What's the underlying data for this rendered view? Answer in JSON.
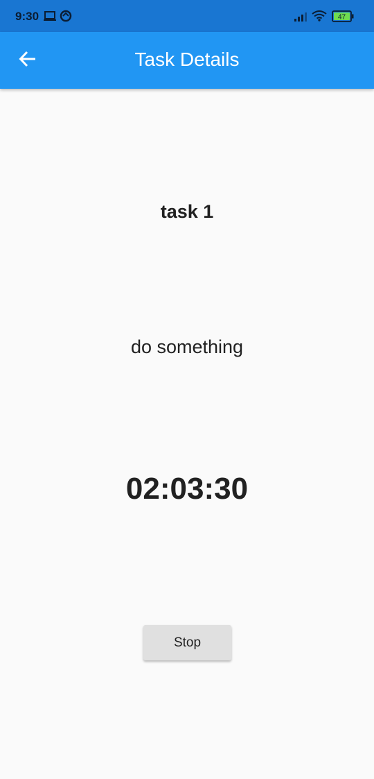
{
  "status_bar": {
    "time": "9:30",
    "battery": "47",
    "icons": [
      "laptop-icon",
      "sync-icon",
      "signal-icon",
      "wifi-icon",
      "battery-icon"
    ]
  },
  "app_bar": {
    "title": "Task Details",
    "back_icon": "arrow-back-icon"
  },
  "task": {
    "title": "task 1",
    "description": "do something",
    "timer": "02:03:30"
  },
  "actions": {
    "stop_label": "Stop"
  },
  "colors": {
    "status_bar": "#1976d2",
    "app_bar": "#2196f3",
    "background": "#fafafa",
    "button": "#e0e0e0",
    "text": "#212121"
  }
}
